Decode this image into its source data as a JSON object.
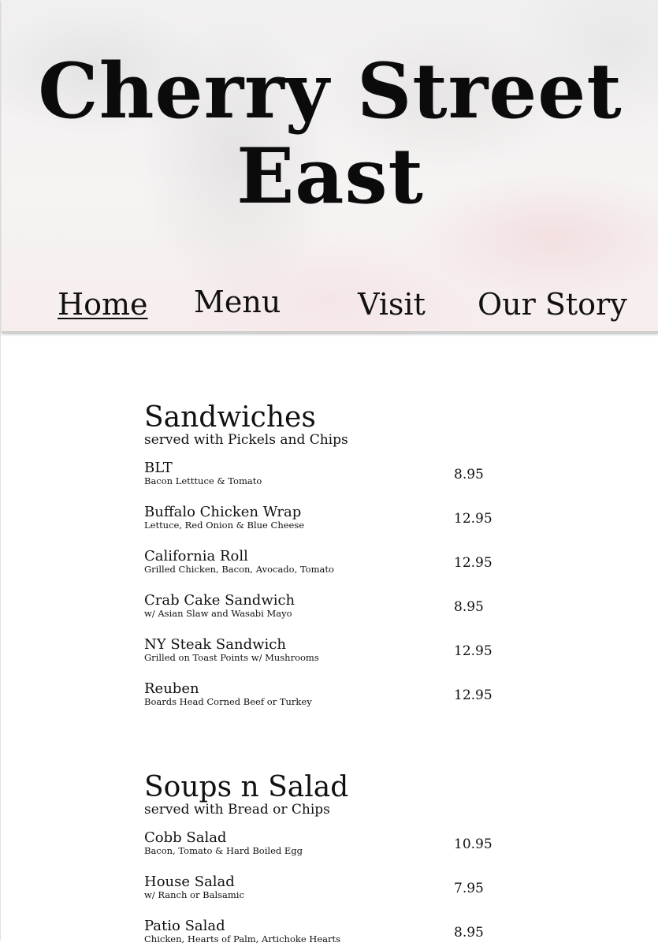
{
  "header": {
    "title": "Cherry Street East",
    "nav": [
      {
        "label": "Home",
        "active": true
      },
      {
        "label": "Menu",
        "active": false
      },
      {
        "label": "Visit",
        "active": false
      },
      {
        "label": "Our Story",
        "active": false
      }
    ]
  },
  "menu": {
    "sections": [
      {
        "title": "Sandwiches",
        "subtitle": "served with Pickels and Chips",
        "items": [
          {
            "name": "BLT",
            "description": "Bacon Letttuce & Tomato",
            "price": "8.95"
          },
          {
            "name": "Buffalo Chicken Wrap",
            "description": "Lettuce, Red Onion & Blue Cheese",
            "price": "12.95"
          },
          {
            "name": "California Roll",
            "description": "Grilled Chicken, Bacon, Avocado, Tomato",
            "price": "12.95"
          },
          {
            "name": "Crab Cake Sandwich",
            "description": "w/ Asian Slaw and Wasabi Mayo",
            "price": "8.95"
          },
          {
            "name": "NY Steak Sandwich",
            "description": "Grilled on Toast Points w/ Mushrooms",
            "price": "12.95"
          },
          {
            "name": "Reuben",
            "description": "Boards Head Corned Beef or Turkey",
            "price": "12.95"
          }
        ]
      },
      {
        "title": "Soups n Salad",
        "subtitle": "served with Bread or Chips",
        "items": [
          {
            "name": "Cobb Salad",
            "description": "Bacon, Tomato & Hard Boiled Egg",
            "price": "10.95"
          },
          {
            "name": "House Salad",
            "description": "w/ Ranch or Balsamic",
            "price": "7.95"
          },
          {
            "name": "Patio Salad",
            "description": "Chicken, Hearts of Palm, Artichoke Hearts",
            "price": "8.95"
          }
        ]
      }
    ]
  }
}
